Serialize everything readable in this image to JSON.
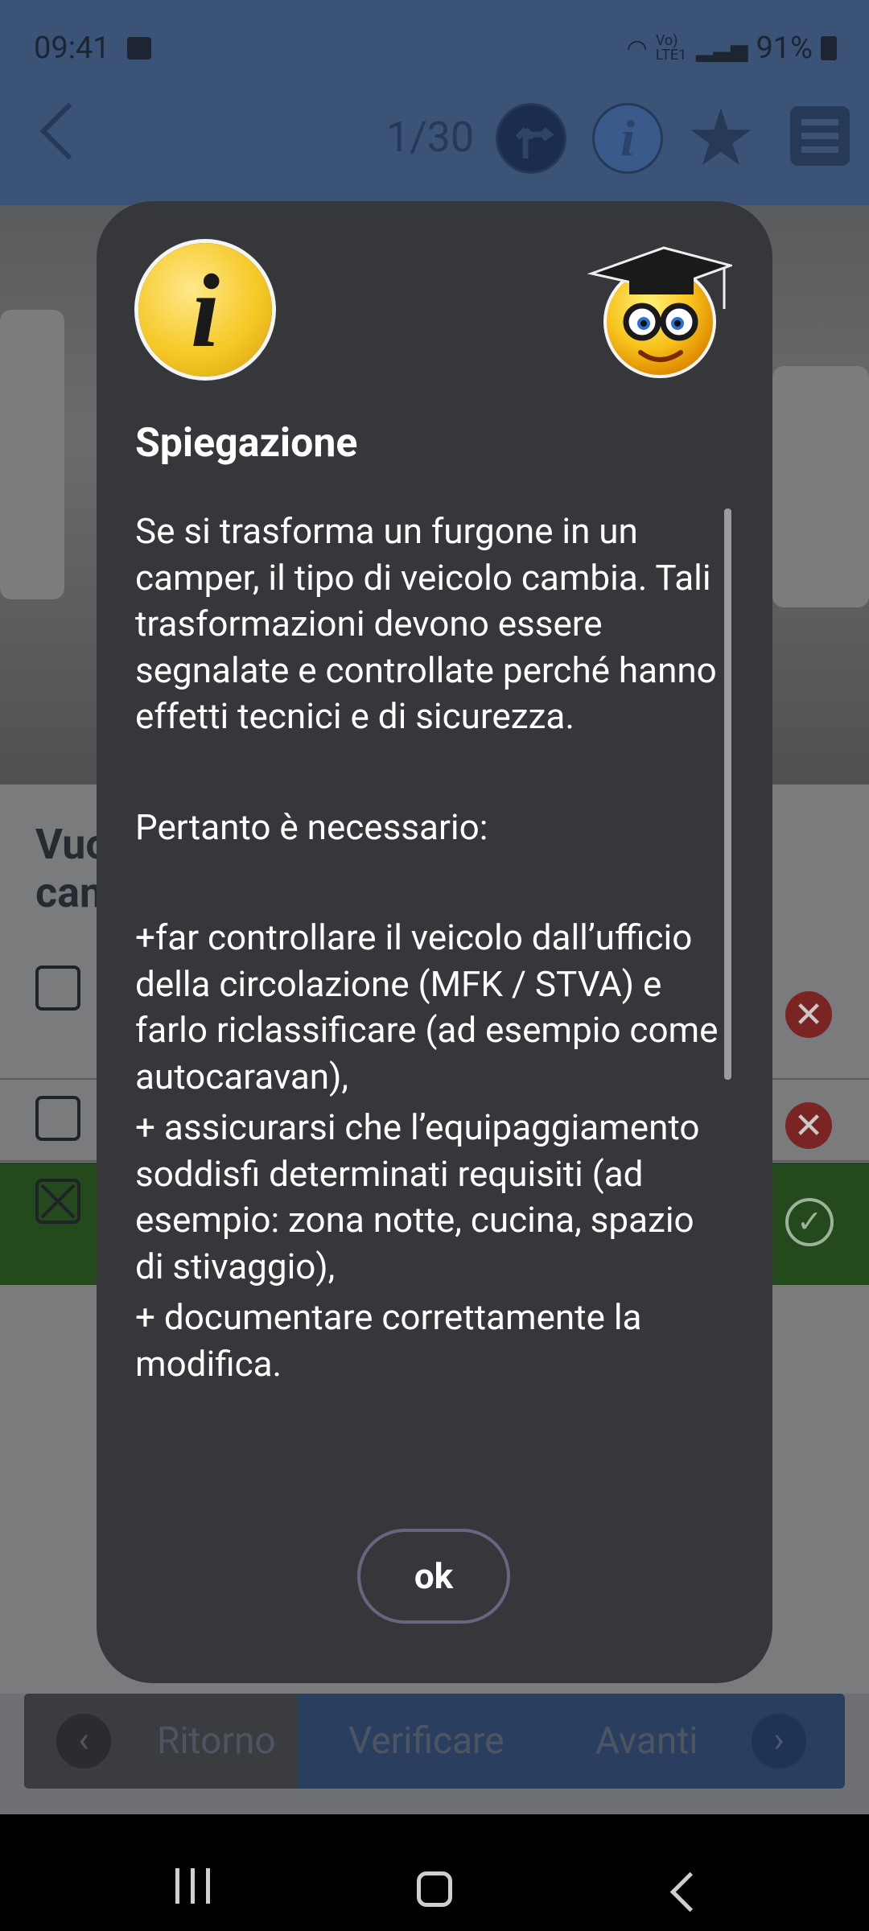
{
  "status_bar": {
    "time": "09:41",
    "network": "Vo) LTE1",
    "battery": "91%"
  },
  "toolbar": {
    "counter": "1/30"
  },
  "question": {
    "partial_text_line1": "Vuo",
    "partial_text_line2": "cam"
  },
  "dialog": {
    "title": "Spiegazione",
    "paragraph1": "Se si trasforma un furgone in un camper, il tipo di veicolo cambia. Tali trasformazioni devono essere segnalate e controllate perché hanno effetti tecnici e di sicurezza.",
    "paragraph2": "Pertanto è necessario:",
    "item1": "+far controllare il veicolo dall’ufficio della circolazione (MFK / STVA) e farlo riclassificare (ad esempio come autocaravan),",
    "item2": "+ assicurarsi che l’equipaggiamento soddisfi determinati requisiti (ad esempio: zona notte, cucina, spazio di stivaggio),",
    "item3": "+ documentare correttamente la modifica.",
    "ok_label": "ok"
  },
  "bottom_bar": {
    "back_label": "Ritorno",
    "check_label": "Verificare",
    "next_label": "Avanti"
  },
  "colors": {
    "dialog_bg": "#36373b",
    "toolbar": "#3a5377",
    "correct_green": "#3f8a32",
    "wrong_red": "#c0392b"
  }
}
